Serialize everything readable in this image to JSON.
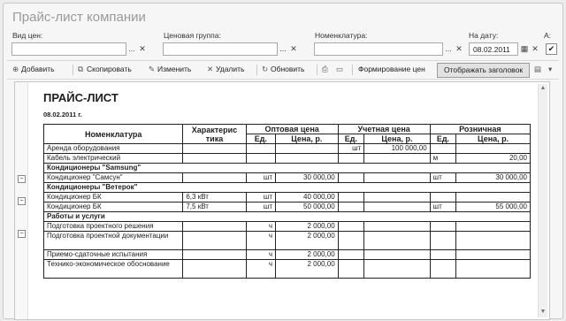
{
  "window": {
    "title": "Прайс-лист компании"
  },
  "filters": {
    "price_type": {
      "label": "Вид цен:",
      "value": ""
    },
    "price_group": {
      "label": "Ценовая группа:",
      "value": ""
    },
    "nomenclature": {
      "label": "Номенклатура:",
      "value": ""
    },
    "date": {
      "label": "На дату:",
      "value": "08.02.2011"
    },
    "a_label": "А:",
    "checked_glyph": "✔",
    "select_glyph": "...",
    "clear_glyph": "✕"
  },
  "toolbar": {
    "add": "Добавить",
    "copy": "Скопировать",
    "edit": "Изменить",
    "delete": "Удалить",
    "refresh": "Обновить",
    "generate": "Формирование цен",
    "show_header": "Отображать заголовок"
  },
  "report": {
    "heading": "ПРАЙС-ЛИСТ",
    "date": "08.02.2011 г.",
    "columns": {
      "name": "Номенклатура",
      "char": "Характерис тика",
      "wholesale": "Оптовая цена",
      "accounting": "Учетная цена",
      "retail": "Розничная",
      "unit": "Ед.",
      "price": "Цена, р."
    },
    "rows": [
      {
        "name": "Аренда оборудования",
        "char": "",
        "w_unit": "",
        "w_price": "",
        "a_unit": "шт",
        "a_price": "100 000,00",
        "r_unit": "",
        "r_price": ""
      },
      {
        "name": "Кабель электрический",
        "char": "",
        "w_unit": "",
        "w_price": "",
        "a_unit": "",
        "a_price": "",
        "r_unit": "м",
        "r_price": "20,00"
      },
      {
        "name": "Кондиционеры \"Samsung\"",
        "group": true
      },
      {
        "name": "Кондиционер \"Самсун\"",
        "char": "",
        "w_unit": "шт",
        "w_price": "30 000,00",
        "a_unit": "",
        "a_price": "",
        "r_unit": "шт",
        "r_price": "30 000,00"
      },
      {
        "name": "Кондиционеры \"Ветерок\"",
        "group": true
      },
      {
        "name": "Кондиционер БК",
        "char": "6,3 кВт",
        "w_unit": "шт",
        "w_price": "40 000,00",
        "a_unit": "",
        "a_price": "",
        "r_unit": "",
        "r_price": ""
      },
      {
        "name": "Кондиционер БК",
        "char": "7,5 кВт",
        "w_unit": "шт",
        "w_price": "50 000,00",
        "a_unit": "",
        "a_price": "",
        "r_unit": "шт",
        "r_price": "55 000,00"
      },
      {
        "name": "Работы и услуги",
        "group": true
      },
      {
        "name": "Подготовка проектного решения",
        "char": "",
        "w_unit": "ч",
        "w_price": "2 000,00",
        "a_unit": "",
        "a_price": "",
        "r_unit": "",
        "r_price": ""
      },
      {
        "name": "Подготовка проектной документации",
        "char": "",
        "w_unit": "ч",
        "w_price": "2 000,00",
        "a_unit": "",
        "a_price": "",
        "r_unit": "",
        "r_price": "",
        "tall": true
      },
      {
        "name": "Приемо-сдаточные испытания",
        "char": "",
        "w_unit": "ч",
        "w_price": "2 000,00",
        "a_unit": "",
        "a_price": "",
        "r_unit": "",
        "r_price": ""
      },
      {
        "name": "Технико-экономическое обоснование",
        "char": "",
        "w_unit": "ч",
        "w_price": "2 000,00",
        "a_unit": "",
        "a_price": "",
        "r_unit": "",
        "r_price": "",
        "tall": true
      }
    ]
  }
}
